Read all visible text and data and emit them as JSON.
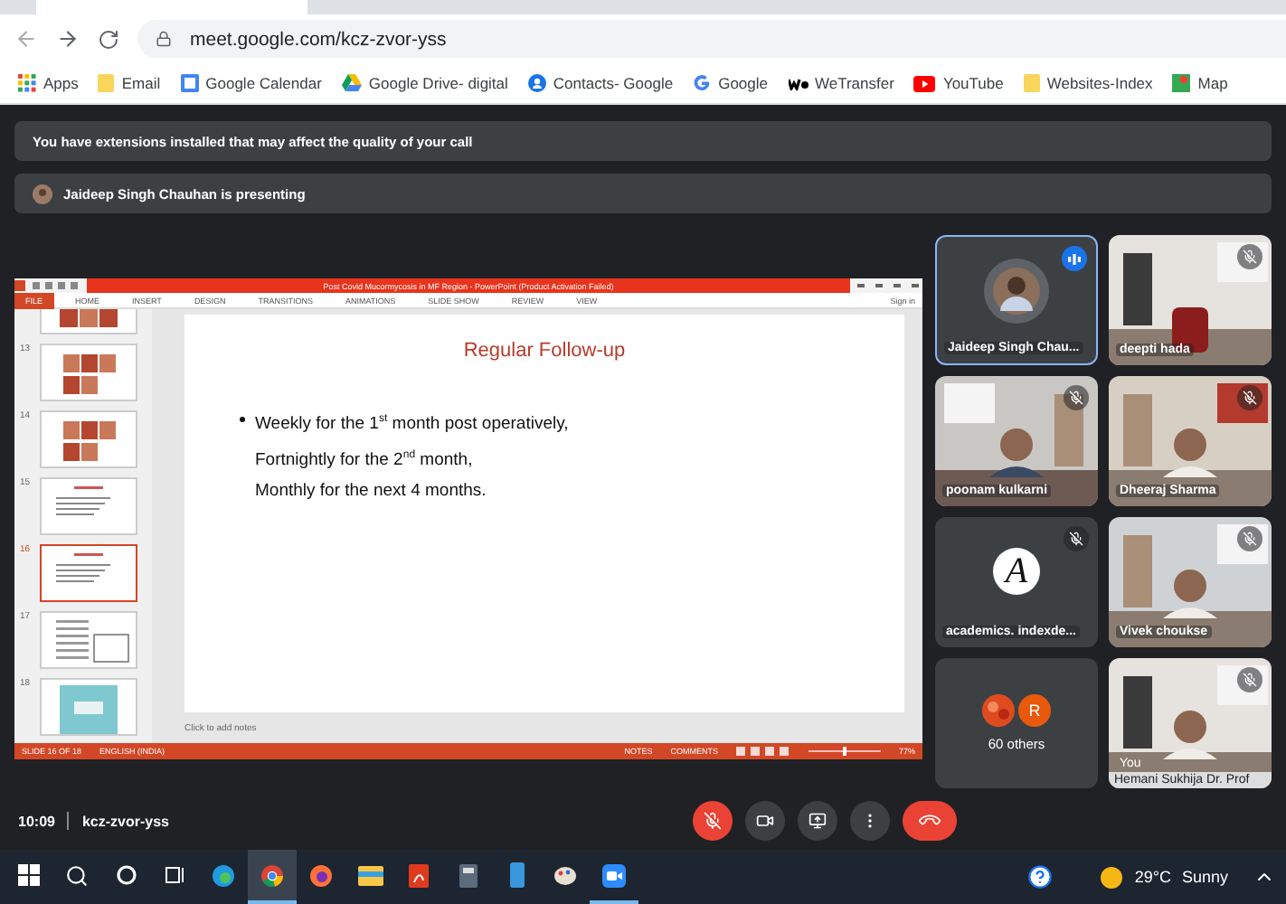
{
  "browser": {
    "url": "meet.google.com/kcz-zvor-yss",
    "bookmarks": [
      {
        "label": "Apps",
        "kind": "apps"
      },
      {
        "label": "Email",
        "kind": "folder"
      },
      {
        "label": "Google Calendar",
        "kind": "calendar"
      },
      {
        "label": "Google Drive- digital",
        "kind": "drive"
      },
      {
        "label": "Contacts- Google",
        "kind": "contacts"
      },
      {
        "label": "Google",
        "kind": "google"
      },
      {
        "label": "WeTransfer",
        "kind": "wetransfer"
      },
      {
        "label": "YouTube",
        "kind": "youtube"
      },
      {
        "label": "Websites-Index",
        "kind": "folder"
      },
      {
        "label": "Map",
        "kind": "maps"
      }
    ]
  },
  "notices": [
    {
      "text": "You have extensions installed that may affect the quality of your call",
      "kind": "info"
    },
    {
      "text": "Jaideep Singh Chauhan is presenting",
      "kind": "presenter"
    }
  ],
  "presentation": {
    "title": "Post Covid Mucormycosis in MF Region - PowerPoint (Product Activation Failed)",
    "sign_in": "Sign in",
    "ribbon_tabs": [
      {
        "label": "FILE",
        "selected": true
      },
      {
        "label": "HOME",
        "selected": false
      },
      {
        "label": "INSERT",
        "selected": false
      },
      {
        "label": "DESIGN",
        "selected": false
      },
      {
        "label": "TRANSITIONS",
        "selected": false
      },
      {
        "label": "ANIMATIONS",
        "selected": false
      },
      {
        "label": "SLIDE SHOW",
        "selected": false
      },
      {
        "label": "REVIEW",
        "selected": false
      },
      {
        "label": "VIEW",
        "selected": false
      }
    ],
    "thumbnails": [
      {
        "kind": "photos",
        "cropped": true,
        "selected": false
      },
      {
        "number": "13",
        "kind": "photos",
        "selected": false
      },
      {
        "number": "14",
        "kind": "photos",
        "selected": false
      },
      {
        "number": "15",
        "kind": "text",
        "selected": false
      },
      {
        "number": "16",
        "kind": "text",
        "selected": true
      },
      {
        "number": "17",
        "kind": "diagram",
        "selected": false
      },
      {
        "number": "18",
        "kind": "picture",
        "selected": false
      }
    ],
    "slide": {
      "title": "Regular Follow-up",
      "lines": [
        {
          "text": "Weekly for the 1$^{st}$ month post operatively,",
          "bullet": true
        },
        {
          "text": "Fortnightly for the 2$^{nd}$ month,",
          "bullet": false
        },
        {
          "text": "Monthly for the next 4 months.",
          "bullet": false
        }
      ]
    },
    "notes_placeholder": "Click to add notes",
    "status": {
      "slide": "SLIDE 16 OF 18",
      "language": "ENGLISH (INDIA)",
      "notes": "NOTES",
      "comments": "COMMENTS",
      "zoom": "77%",
      "level": 0.5
    }
  },
  "tiles": [
    {
      "name": "Jaideep Singh Chau...",
      "kind": "avatar",
      "speaking": true,
      "muted": false
    },
    {
      "name": "deepti hada",
      "kind": "video",
      "speaking": false,
      "muted": true
    },
    {
      "name": "poonam kulkarni",
      "kind": "video",
      "speaking": false,
      "muted": true
    },
    {
      "name": "Dheeraj Sharma",
      "kind": "video",
      "speaking": false,
      "muted": true
    },
    {
      "name": "academics. indexde...",
      "kind": "letter",
      "letter": "A",
      "speaking": false,
      "muted": true
    },
    {
      "name": "Vivek choukse",
      "kind": "video",
      "speaking": false,
      "muted": true
    },
    {
      "name": "60 others",
      "kind": "others",
      "letter": "R",
      "speaking": false,
      "muted": false
    },
    {
      "name": "Hemani Sukhija Dr. Prof",
      "kind": "self",
      "tag": "You",
      "speaking": false,
      "muted": true
    }
  ],
  "call": {
    "time": "10:09",
    "code": "kcz-zvor-yss",
    "controls": [
      {
        "kind": "mic",
        "on": false
      },
      {
        "kind": "camera",
        "on": true
      },
      {
        "kind": "present"
      },
      {
        "kind": "more"
      },
      {
        "kind": "hangup"
      }
    ]
  },
  "taskbar": {
    "apps": [
      {
        "kind": "start",
        "active": false,
        "running": false
      },
      {
        "kind": "search",
        "active": false,
        "running": false
      },
      {
        "kind": "assistant",
        "active": false,
        "running": false
      },
      {
        "kind": "taskview",
        "active": false,
        "running": false
      },
      {
        "kind": "edge",
        "active": false,
        "running": false
      },
      {
        "kind": "chrome",
        "active": true,
        "running": true
      },
      {
        "kind": "firefox",
        "active": false,
        "running": false
      },
      {
        "kind": "explorer",
        "active": false,
        "running": false
      },
      {
        "kind": "acrobat",
        "active": false,
        "running": false
      },
      {
        "kind": "calculator",
        "active": false,
        "running": false
      },
      {
        "kind": "phone",
        "active": false,
        "running": false
      },
      {
        "kind": "paint",
        "active": false,
        "running": false
      },
      {
        "kind": "zoom",
        "active": false,
        "running": true
      }
    ],
    "weather": {
      "temp": "29°C",
      "condition": "Sunny"
    }
  }
}
